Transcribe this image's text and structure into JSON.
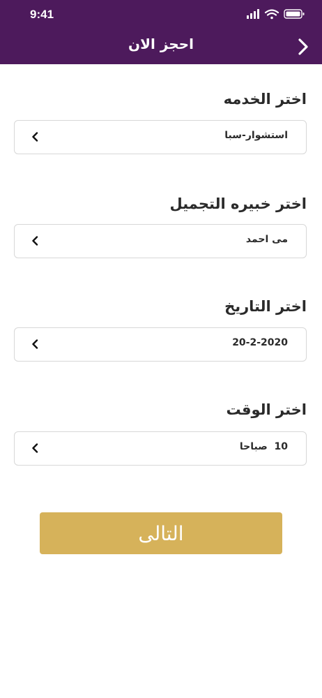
{
  "status_bar": {
    "time": "9:41"
  },
  "header": {
    "title": "احجز الان"
  },
  "form": {
    "fields": [
      {
        "label": "اختر الخدمه",
        "value": "استشوار-سبا"
      },
      {
        "label": "اختر خبيره التجميل",
        "value": "مى احمد"
      },
      {
        "label": "اختر التاريخ",
        "value": "20-2-2020"
      },
      {
        "label": "اختر الوقت",
        "value": "10  صباحا"
      }
    ],
    "next_label": "التالى"
  },
  "colors": {
    "header_bg": "#4d1a5c",
    "button_bg": "#d6b25a"
  },
  "icons": {
    "back": "chevron-right-icon",
    "dropdown": "chevron-left-icon",
    "signal": "cellular-signal-icon",
    "wifi": "wifi-icon",
    "battery": "battery-icon"
  }
}
